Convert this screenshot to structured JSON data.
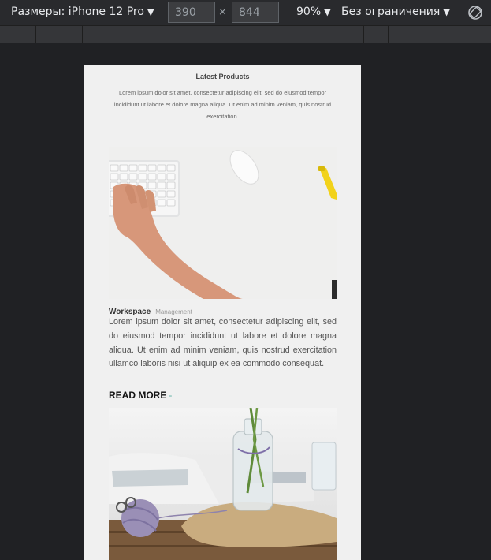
{
  "toolbar": {
    "device_label": "Размеры: iPhone 12 Pro",
    "width_value": "390",
    "height_value": "844",
    "times": "×",
    "zoom": "90%",
    "throttle": "Без ограничения"
  },
  "page": {
    "section_title": "Latest Products",
    "section_desc": "Lorem ipsum dolor sit amet, consectetur adipiscing elit, sed do eiusmod tempor incididunt ut labore et dolore magna aliqua. Ut enim ad minim veniam, quis nostrud exercitation.",
    "card": {
      "title": "Workspace",
      "tag": "Management",
      "text": "Lorem ipsum dolor sit amet, consectetur adipiscing elit, sed do eiusmod tempor incididunt ut labore et dolore magna aliqua. Ut enim ad minim veniam, quis nostrud exercitation ullamco laboris nisi ut aliquip ex ea commodo consequat.",
      "read_more": "READ MORE",
      "dash": "-"
    }
  },
  "icons": {
    "caret": "chevron-down-icon",
    "rotate": "rotate-icon"
  }
}
